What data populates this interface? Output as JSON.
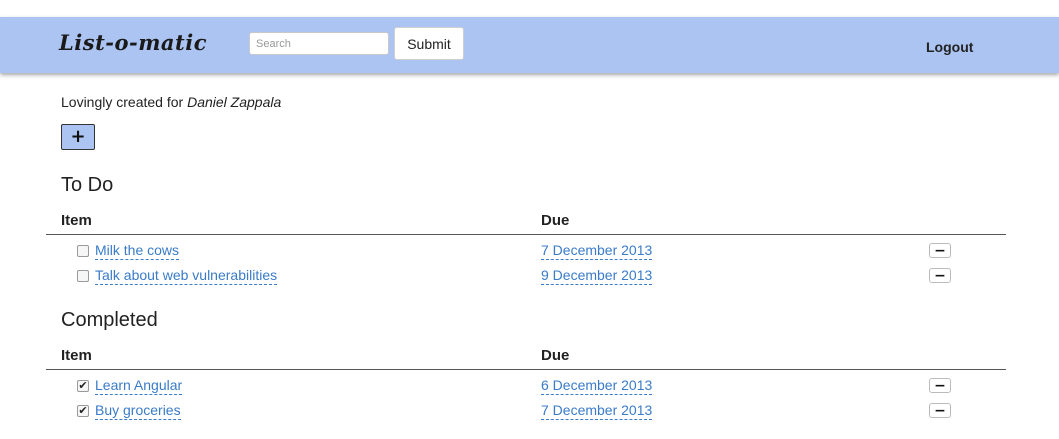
{
  "header": {
    "brand": "List-o-matic",
    "search_placeholder": "Search",
    "submit_label": "Submit",
    "logout_label": "Logout",
    "accent_color": "#abc4f2"
  },
  "main": {
    "created_prefix": "Lovingly created for ",
    "created_user": "Daniel Zappala",
    "add_label": "+",
    "todo": {
      "title": "To Do",
      "col_item": "Item",
      "col_due": "Due",
      "items": [
        {
          "name": "Milk the cows",
          "due": "7 December 2013",
          "checked": false,
          "delete_label": "−"
        },
        {
          "name": "Talk about web vulnerabilities",
          "due": "9 December 2013",
          "checked": false,
          "delete_label": "−"
        }
      ]
    },
    "completed": {
      "title": "Completed",
      "col_item": "Item",
      "col_due": "Due",
      "items": [
        {
          "name": "Learn Angular",
          "due": "6 December 2013",
          "checked": true,
          "check_mark": "✔",
          "delete_label": "−"
        },
        {
          "name": "Buy groceries",
          "due": "7 December 2013",
          "checked": true,
          "check_mark": "✔",
          "delete_label": "−"
        }
      ]
    }
  }
}
